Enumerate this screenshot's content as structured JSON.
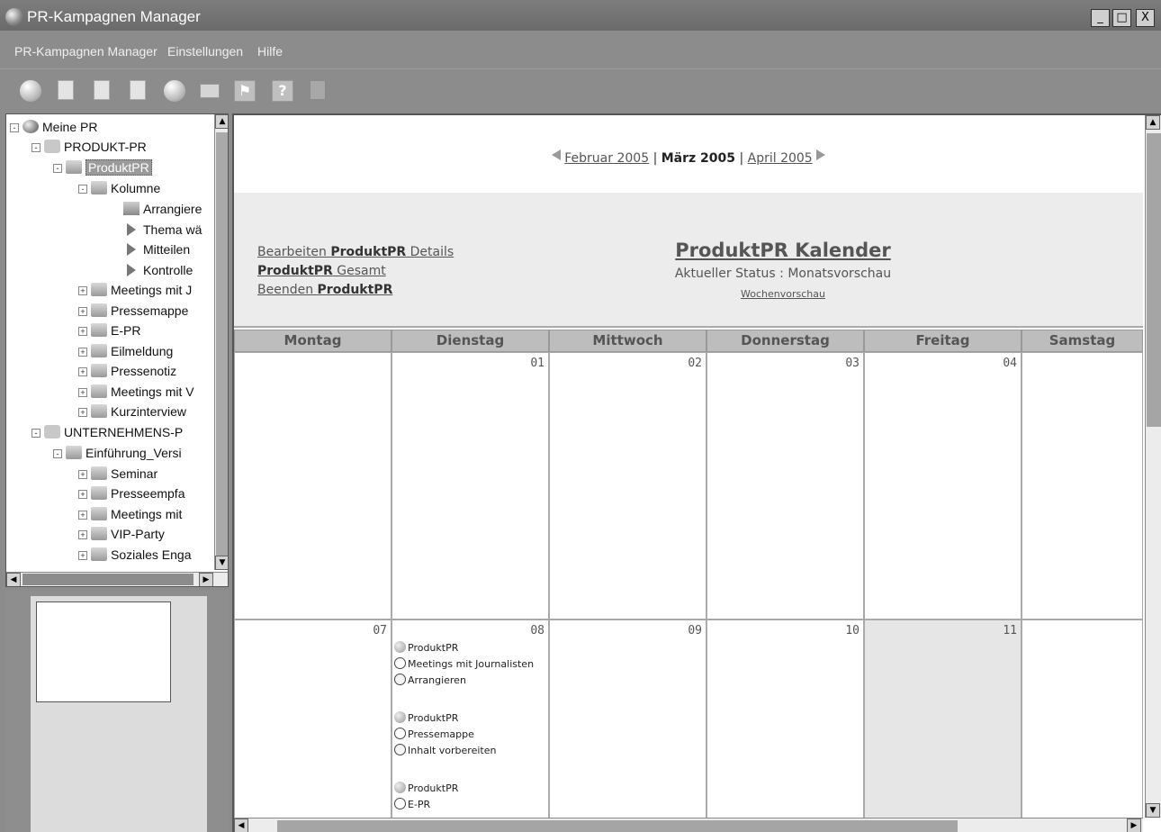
{
  "window": {
    "title": "PR-Kampagnen Manager",
    "buttons": {
      "minimize": "_",
      "maximize": "□",
      "close": "X"
    }
  },
  "menu": [
    "PR-Kampagnen Manager",
    "Einstellungen",
    "Hilfe"
  ],
  "toolbar": {
    "icons": [
      "globe-icon",
      "new-document-icon",
      "edit-document-icon",
      "delete-document-icon",
      "web-icon",
      "mail-icon",
      "share-icon",
      "help-icon",
      "exit-icon"
    ],
    "help_label": "?"
  },
  "tree": {
    "root": "Meine PR",
    "group1": "PRODUKT-PR",
    "selected": "ProduktPR",
    "kolumne": "Kolumne",
    "arrangiere": "Arrangiere",
    "thema": "Thema wä",
    "mitteilen": "Mitteilen",
    "kontrolle": "Kontrolle",
    "meetings1": "Meetings mit J",
    "pressemappe": "Pressemappe",
    "epr": "E-PR",
    "eilmeldung": "Eilmeldung",
    "pressenotiz": "Pressenotiz",
    "meetings2": "Meetings mit V",
    "kurzinterview": "Kurzinterview",
    "group2": "UNTERNEHMENS-P",
    "einfuehrung": "Einführung_Versi",
    "seminar": "Seminar",
    "presseempfang": "Presseempfa",
    "meetings3": "Meetings mit",
    "vipparty": "VIP-Party",
    "soziales": "Soziales Enga"
  },
  "calendar": {
    "nav": {
      "prev": "Februar 2005",
      "current": "März 2005",
      "next": "April 2005",
      "sep": "|"
    },
    "links": {
      "edit_prefix": "Bearbeiten ",
      "edit_bold": "ProduktPR",
      "edit_suffix": " Details",
      "total_bold": "ProduktPR",
      "total_suffix": " Gesamt",
      "end_prefix": "Beenden ",
      "end_bold": "ProduktPR"
    },
    "title": "ProduktPR Kalender",
    "status": "Aktueller Status : Monatsvorschau",
    "week_link": "Wochenvorschau",
    "days": [
      "Montag",
      "Dienstag",
      "Mittwoch",
      "Donnerstag",
      "Freitag",
      "Samstag"
    ],
    "week1": [
      "",
      "01",
      "02",
      "03",
      "04",
      ""
    ],
    "week2": [
      "07",
      "08",
      "09",
      "10",
      "11",
      ""
    ],
    "events": [
      {
        "project": "ProduktPR",
        "task": "Meetings mit Journalisten",
        "step": "Arrangieren"
      },
      {
        "project": "ProduktPR",
        "task": "Pressemappe",
        "step": "Inhalt vorbereiten"
      },
      {
        "project": "ProduktPR",
        "task": "E-PR",
        "step": ""
      }
    ]
  }
}
